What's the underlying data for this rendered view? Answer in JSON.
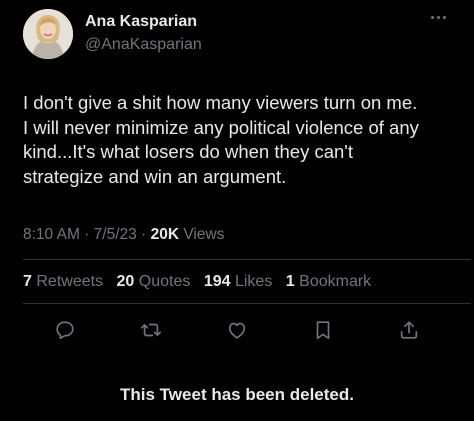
{
  "author": {
    "name": "Ana Kasparian",
    "handle": "@AnaKasparian",
    "avatar_icon": "profile-photo"
  },
  "tweet": {
    "text": "I don't give a shit how many viewers turn on me.\nI will never minimize any political violence of any\nkind...It's what losers do when they can't\nstrategize and win an argument.",
    "time": "8:10 AM",
    "date": "7/5/23",
    "views_count": "20K",
    "views_label": "Views",
    "separator": "·"
  },
  "stats": {
    "retweets_count": "7",
    "retweets_label": "Retweets",
    "quotes_count": "20",
    "quotes_label": "Quotes",
    "likes_count": "194",
    "likes_label": "Likes",
    "bookmarks_count": "1",
    "bookmarks_label": "Bookmark"
  },
  "actions": [
    "reply-icon",
    "retweet-icon",
    "like-icon",
    "bookmark-icon",
    "share-icon"
  ],
  "notice": "This Tweet has been deleted.",
  "colors": {
    "background": "#000000",
    "primary_text": "#e7e9ea",
    "secondary_text": "#71767b",
    "divider": "#2f3336"
  }
}
